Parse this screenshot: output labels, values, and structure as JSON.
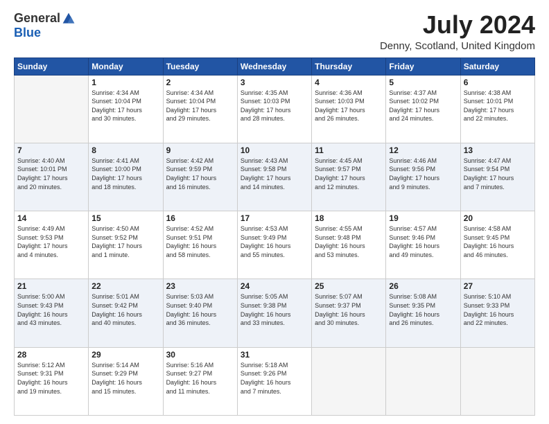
{
  "header": {
    "logo_general": "General",
    "logo_blue": "Blue",
    "month_title": "July 2024",
    "location": "Denny, Scotland, United Kingdom"
  },
  "days_of_week": [
    "Sunday",
    "Monday",
    "Tuesday",
    "Wednesday",
    "Thursday",
    "Friday",
    "Saturday"
  ],
  "weeks": [
    [
      {
        "day": "",
        "info": ""
      },
      {
        "day": "1",
        "info": "Sunrise: 4:34 AM\nSunset: 10:04 PM\nDaylight: 17 hours\nand 30 minutes."
      },
      {
        "day": "2",
        "info": "Sunrise: 4:34 AM\nSunset: 10:04 PM\nDaylight: 17 hours\nand 29 minutes."
      },
      {
        "day": "3",
        "info": "Sunrise: 4:35 AM\nSunset: 10:03 PM\nDaylight: 17 hours\nand 28 minutes."
      },
      {
        "day": "4",
        "info": "Sunrise: 4:36 AM\nSunset: 10:03 PM\nDaylight: 17 hours\nand 26 minutes."
      },
      {
        "day": "5",
        "info": "Sunrise: 4:37 AM\nSunset: 10:02 PM\nDaylight: 17 hours\nand 24 minutes."
      },
      {
        "day": "6",
        "info": "Sunrise: 4:38 AM\nSunset: 10:01 PM\nDaylight: 17 hours\nand 22 minutes."
      }
    ],
    [
      {
        "day": "7",
        "info": "Sunrise: 4:40 AM\nSunset: 10:01 PM\nDaylight: 17 hours\nand 20 minutes."
      },
      {
        "day": "8",
        "info": "Sunrise: 4:41 AM\nSunset: 10:00 PM\nDaylight: 17 hours\nand 18 minutes."
      },
      {
        "day": "9",
        "info": "Sunrise: 4:42 AM\nSunset: 9:59 PM\nDaylight: 17 hours\nand 16 minutes."
      },
      {
        "day": "10",
        "info": "Sunrise: 4:43 AM\nSunset: 9:58 PM\nDaylight: 17 hours\nand 14 minutes."
      },
      {
        "day": "11",
        "info": "Sunrise: 4:45 AM\nSunset: 9:57 PM\nDaylight: 17 hours\nand 12 minutes."
      },
      {
        "day": "12",
        "info": "Sunrise: 4:46 AM\nSunset: 9:56 PM\nDaylight: 17 hours\nand 9 minutes."
      },
      {
        "day": "13",
        "info": "Sunrise: 4:47 AM\nSunset: 9:54 PM\nDaylight: 17 hours\nand 7 minutes."
      }
    ],
    [
      {
        "day": "14",
        "info": "Sunrise: 4:49 AM\nSunset: 9:53 PM\nDaylight: 17 hours\nand 4 minutes."
      },
      {
        "day": "15",
        "info": "Sunrise: 4:50 AM\nSunset: 9:52 PM\nDaylight: 17 hours\nand 1 minute."
      },
      {
        "day": "16",
        "info": "Sunrise: 4:52 AM\nSunset: 9:51 PM\nDaylight: 16 hours\nand 58 minutes."
      },
      {
        "day": "17",
        "info": "Sunrise: 4:53 AM\nSunset: 9:49 PM\nDaylight: 16 hours\nand 55 minutes."
      },
      {
        "day": "18",
        "info": "Sunrise: 4:55 AM\nSunset: 9:48 PM\nDaylight: 16 hours\nand 53 minutes."
      },
      {
        "day": "19",
        "info": "Sunrise: 4:57 AM\nSunset: 9:46 PM\nDaylight: 16 hours\nand 49 minutes."
      },
      {
        "day": "20",
        "info": "Sunrise: 4:58 AM\nSunset: 9:45 PM\nDaylight: 16 hours\nand 46 minutes."
      }
    ],
    [
      {
        "day": "21",
        "info": "Sunrise: 5:00 AM\nSunset: 9:43 PM\nDaylight: 16 hours\nand 43 minutes."
      },
      {
        "day": "22",
        "info": "Sunrise: 5:01 AM\nSunset: 9:42 PM\nDaylight: 16 hours\nand 40 minutes."
      },
      {
        "day": "23",
        "info": "Sunrise: 5:03 AM\nSunset: 9:40 PM\nDaylight: 16 hours\nand 36 minutes."
      },
      {
        "day": "24",
        "info": "Sunrise: 5:05 AM\nSunset: 9:38 PM\nDaylight: 16 hours\nand 33 minutes."
      },
      {
        "day": "25",
        "info": "Sunrise: 5:07 AM\nSunset: 9:37 PM\nDaylight: 16 hours\nand 30 minutes."
      },
      {
        "day": "26",
        "info": "Sunrise: 5:08 AM\nSunset: 9:35 PM\nDaylight: 16 hours\nand 26 minutes."
      },
      {
        "day": "27",
        "info": "Sunrise: 5:10 AM\nSunset: 9:33 PM\nDaylight: 16 hours\nand 22 minutes."
      }
    ],
    [
      {
        "day": "28",
        "info": "Sunrise: 5:12 AM\nSunset: 9:31 PM\nDaylight: 16 hours\nand 19 minutes."
      },
      {
        "day": "29",
        "info": "Sunrise: 5:14 AM\nSunset: 9:29 PM\nDaylight: 16 hours\nand 15 minutes."
      },
      {
        "day": "30",
        "info": "Sunrise: 5:16 AM\nSunset: 9:27 PM\nDaylight: 16 hours\nand 11 minutes."
      },
      {
        "day": "31",
        "info": "Sunrise: 5:18 AM\nSunset: 9:26 PM\nDaylight: 16 hours\nand 7 minutes."
      },
      {
        "day": "",
        "info": ""
      },
      {
        "day": "",
        "info": ""
      },
      {
        "day": "",
        "info": ""
      }
    ]
  ]
}
